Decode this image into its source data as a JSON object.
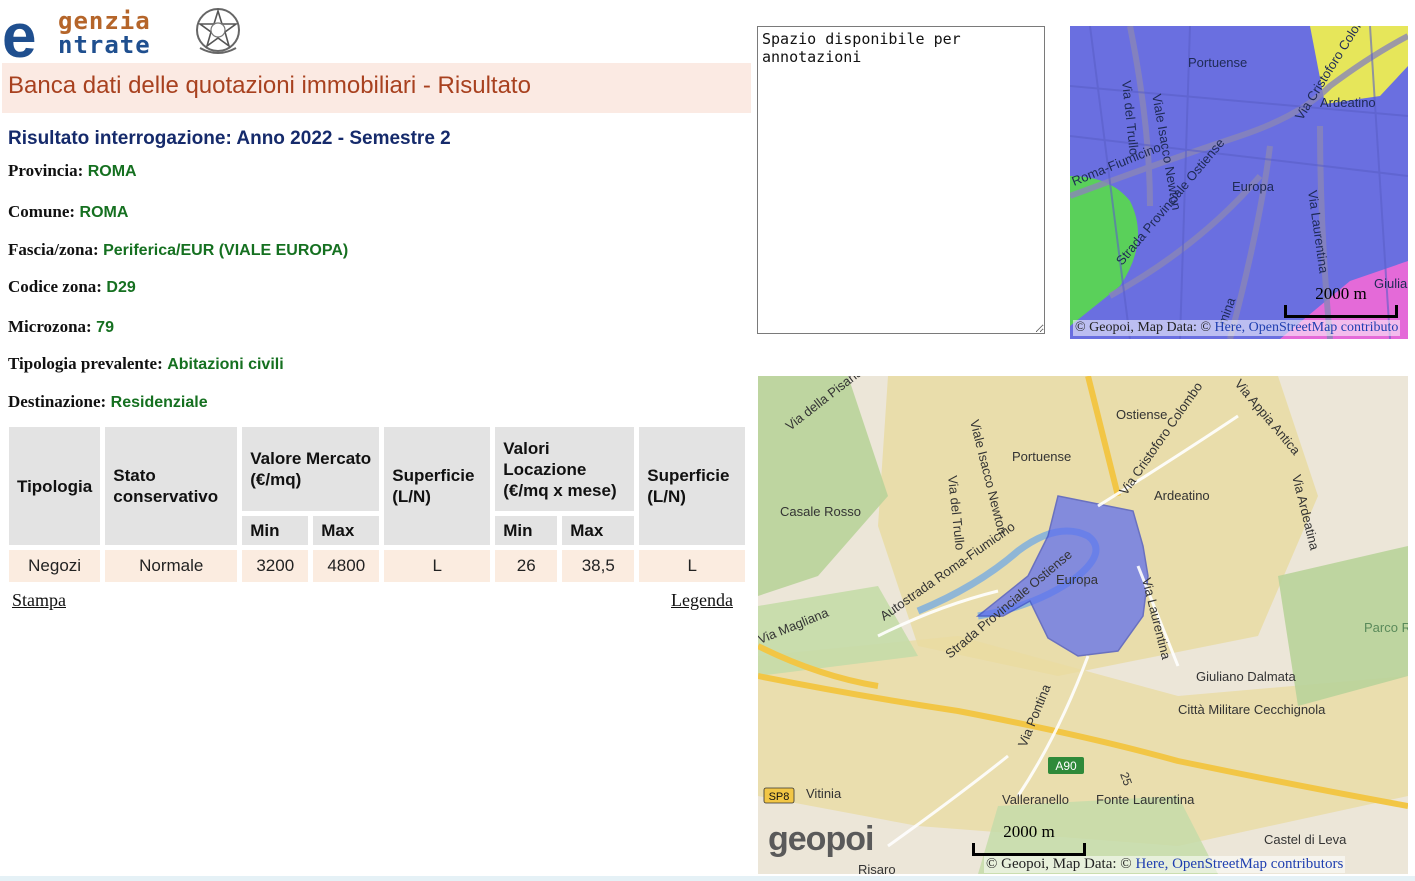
{
  "logo": {
    "line1": "genzia",
    "line2": "ntrate",
    "letter": "e"
  },
  "title": "Banca dati delle quotazioni immobiliari - Risultato",
  "result_heading": "Risultato interrogazione: Anno 2022 - Semestre 2",
  "fields": {
    "provincia": {
      "label": "Provincia:",
      "value": "ROMA"
    },
    "comune": {
      "label": "Comune:",
      "value": "ROMA"
    },
    "fascia": {
      "label": "Fascia/zona:",
      "value": "Periferica/EUR (VIALE EUROPA)"
    },
    "codice": {
      "label": "Codice zona:",
      "value": "D29"
    },
    "microzona": {
      "label": "Microzona:",
      "value": "79"
    },
    "tipologia": {
      "label": "Tipologia prevalente:",
      "value": "Abitazioni civili"
    },
    "destinazione": {
      "label": "Destinazione:",
      "value": "Residenziale"
    }
  },
  "table": {
    "headers": {
      "tipologia": "Tipologia",
      "stato": "Stato conservativo",
      "valore_mercato": "Valore Mercato (€/mq)",
      "superficie": "Superficie (L/N)",
      "valori_locazione": "Valori Locazione (€/mq x mese)",
      "superficie2": "Superficie (L/N)",
      "min": "Min",
      "max": "Max"
    },
    "row": {
      "tipologia": "Negozi",
      "stato": "Normale",
      "vm_min": "3200",
      "vm_max": "4800",
      "superficie": "L",
      "vl_min": "26",
      "vl_max": "38,5",
      "superficie2": "L"
    }
  },
  "links": {
    "stampa": "Stampa",
    "legenda": "Legenda"
  },
  "notes_text": "Spazio disponibile per annotazioni",
  "map_small": {
    "labels": [
      "Portuense",
      "Ardeatino",
      "Europa",
      "Viale Isacco Newton",
      "Via del Trullo",
      "Via Cristoforo Colombo",
      "Roma-Fiumicino",
      "Strada Provinciale Ostiense",
      "Via Laurentina",
      "Giulia",
      "mina"
    ],
    "scale": "2000 m",
    "attribution_prefix": "© Geopoi, Map Data: © ",
    "attribution_links": "Here, OpenStreetMap contributo"
  },
  "map_big": {
    "labels": [
      "Via della Pisana",
      "Ostiense",
      "Via Appia Antica",
      "Portuense",
      "Viale Isacco Newton",
      "Via Cristoforo Colombo",
      "Casale Rosso",
      "Via del Trullo",
      "Ardeatino",
      "Via Ardeatina",
      "Autostrada Roma-Fiumicino",
      "Strada Provinciale Ostiense",
      "Europa",
      "Via Laurentina",
      "Via Magliana",
      "Parco Regionale",
      "Giuliano Dalmata",
      "Città Militare Cecchignola",
      "Via Pontina",
      "Vitinia",
      "Valleranello",
      "Fonte Laurentina",
      "Castel di Leva",
      "Risaro",
      "A90",
      "SP8",
      "25"
    ],
    "scale": "2000 m",
    "attribution_prefix": "© Geopoi, Map Data: © ",
    "attribution_links": "Here, OpenStreetMap contributors",
    "brand": "geopoi"
  },
  "colors": {
    "title_bg": "#fbeae3",
    "title_text": "#a8411f",
    "heading": "#152a6b",
    "value_green": "#157020",
    "zone_fill": "#5c6cf0",
    "map_base": "#ece6d8"
  }
}
